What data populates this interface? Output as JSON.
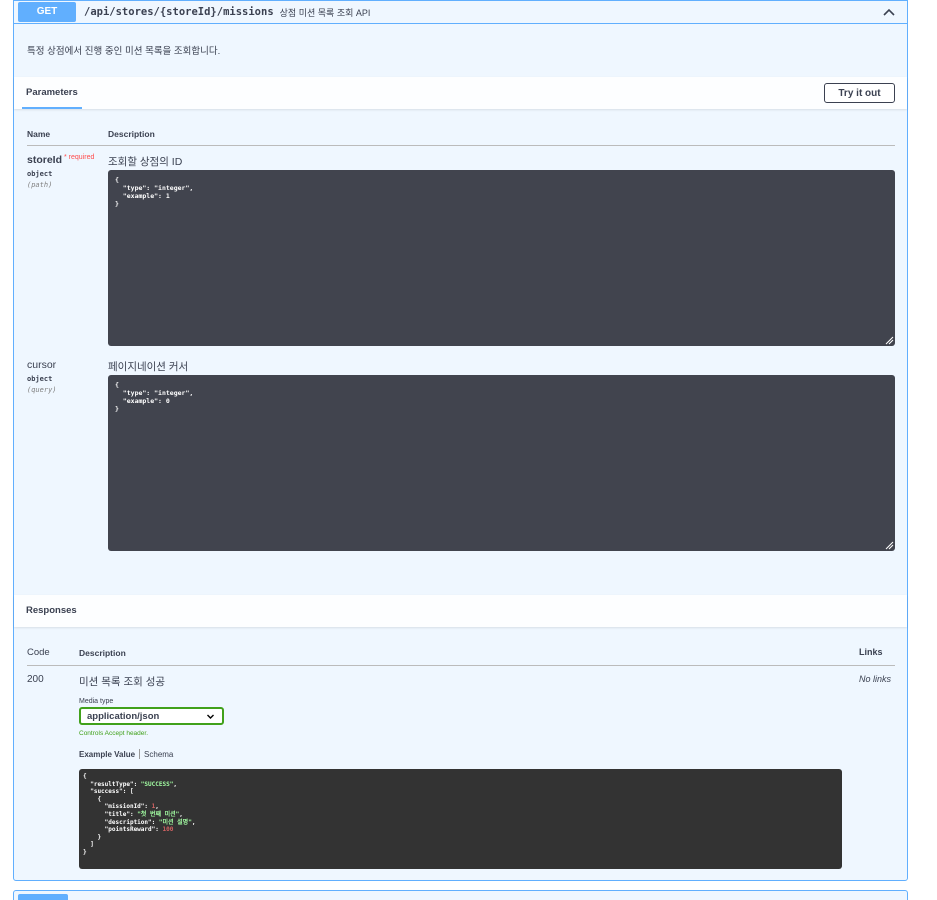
{
  "operation": {
    "method": "GET",
    "path": "/api/stores/{storeId}/missions",
    "summary": "상점 미션 목록 조회 API",
    "description": "특정 상점에서 진행 중인 미션 목록을 조회합니다."
  },
  "parameters": {
    "tab_label": "Parameters",
    "try_button": "Try it out",
    "col_name": "Name",
    "col_description": "Description",
    "items": [
      {
        "name": "storeId",
        "required_label": "* required",
        "type": "object",
        "in": "(path)",
        "description": "조회할 상점의 ID",
        "schema_lines": [
          "{",
          "  \"type\": \"integer\",",
          "  \"example\": 1",
          "}"
        ]
      },
      {
        "name": "cursor",
        "type": "object",
        "in": "(query)",
        "description": "페이지네이션 커서",
        "schema_lines": [
          "{",
          "  \"type\": \"integer\",",
          "  \"example\": 0",
          "}"
        ]
      }
    ]
  },
  "responses": {
    "title": "Responses",
    "col_code": "Code",
    "col_description": "Description",
    "col_links": "Links",
    "rows": [
      {
        "code": "200",
        "description": "미션 목록 조회 성공",
        "links": "No links",
        "media_type_label": "Media type",
        "media_type": "application/json",
        "controls_accept": "Controls Accept header.",
        "example_tab": "Example Value",
        "schema_tab": "Schema",
        "example": {
          "resultType": "SUCCESS",
          "missionId": "1",
          "title": "첫 번째 미션",
          "description": "미션 설명",
          "pointsReward": "100"
        }
      }
    ]
  }
}
